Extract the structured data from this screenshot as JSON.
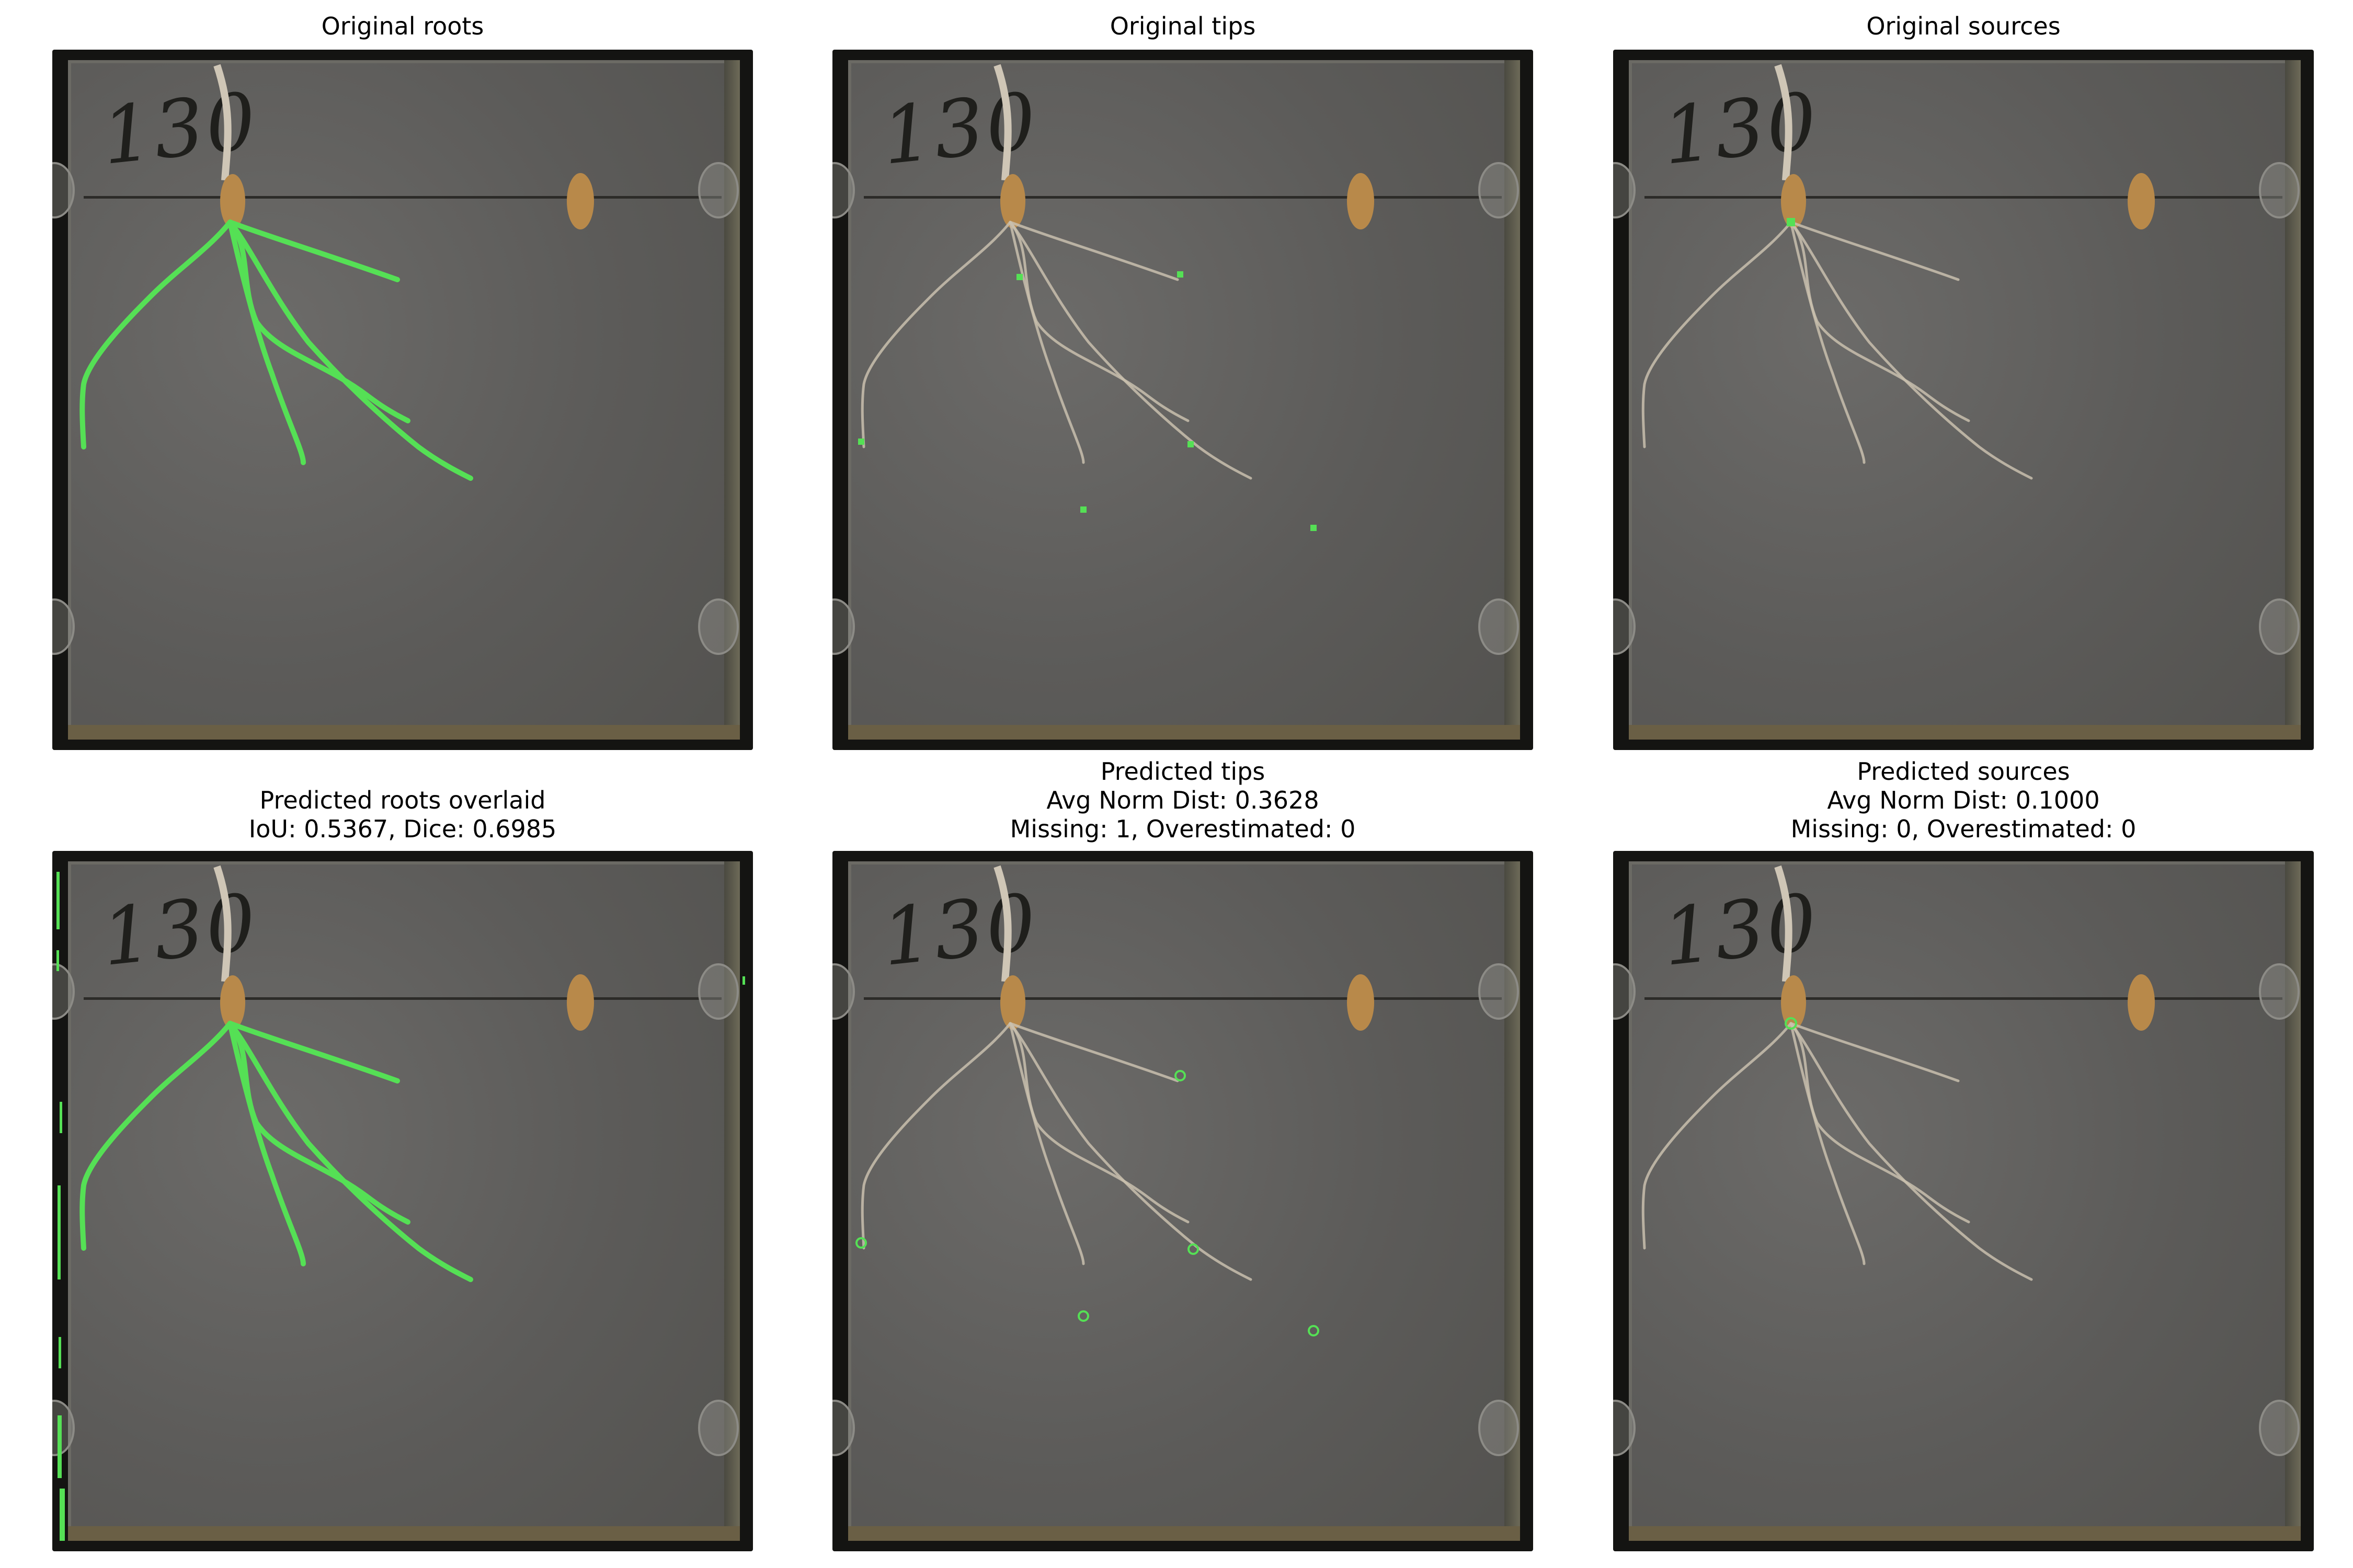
{
  "figure": {
    "panels": [
      {
        "id": "original-roots",
        "title": [
          "Original roots"
        ],
        "overlay": "root-mask"
      },
      {
        "id": "original-tips",
        "title": [
          "Original tips"
        ],
        "overlay": "tip-squares"
      },
      {
        "id": "original-sources",
        "title": [
          "Original sources"
        ],
        "overlay": "source-square"
      },
      {
        "id": "predicted-roots",
        "title": [
          "Predicted roots overlaid",
          "IoU: 0.5367, Dice: 0.6985"
        ],
        "overlay": "root-mask-pred"
      },
      {
        "id": "predicted-tips",
        "title": [
          "Predicted tips",
          "Avg Norm Dist: 0.3628",
          "Missing: 1, Overestimated: 0"
        ],
        "overlay": "tip-circles"
      },
      {
        "id": "predicted-sources",
        "title": [
          "Predicted sources",
          "Avg Norm Dist: 0.1000",
          "Missing: 0, Overestimated: 0"
        ],
        "overlay": "source-circle"
      }
    ],
    "plate_label": "130",
    "colors": {
      "overlay_green": "#55e055",
      "root_beige": "#c9bfae",
      "seed_brown": "#b8894a"
    }
  }
}
